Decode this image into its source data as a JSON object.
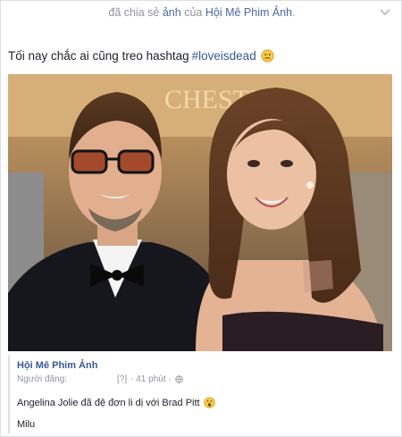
{
  "header": {
    "action_text": "đã chia sẻ",
    "link_text": "ảnh",
    "middle_text": "của",
    "page_name": "Hội Mê Phim Ảnh",
    "end_punct": "."
  },
  "post": {
    "text": "Tối nay chắc ai cũng treo hashtag",
    "hashtag": "#loveisdead",
    "emoji": "frown-emoji"
  },
  "photo": {
    "icon": "photo-couple-red-carpet",
    "background_text": "CHESTRE"
  },
  "shared": {
    "source_name": "Hội Mê Phim Ảnh",
    "author_label": "Người đăng:",
    "author_value": "[?]",
    "time": "· 41 phút ·",
    "privacy_icon": "globe-icon",
    "body": "Angelina Jolie đã đệ đơn li dị với Brad Pitt",
    "body_emoji": "gasp-emoji",
    "signature": "Milu"
  },
  "colors": {
    "link": "#365899",
    "muted": "#90949c",
    "text": "#1d2129",
    "border": "#dddfe2"
  }
}
